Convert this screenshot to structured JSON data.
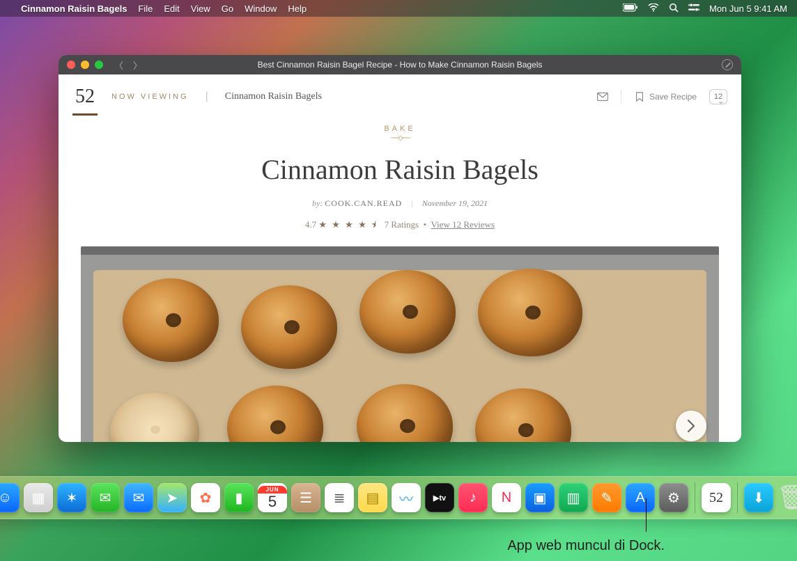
{
  "menubar": {
    "app_name": "Cinnamon Raisin Bagels",
    "items": [
      "File",
      "Edit",
      "View",
      "Go",
      "Window",
      "Help"
    ],
    "datetime": "Mon Jun 5  9:41 AM"
  },
  "window": {
    "title": "Best Cinnamon Raisin Bagel Recipe - How to Make Cinnamon Raisin Bagels",
    "header": {
      "logo_text": "52",
      "now_viewing_label": "NOW VIEWING",
      "breadcrumb_title": "Cinnamon Raisin Bagels",
      "save_label": "Save Recipe",
      "comment_count": "12"
    },
    "content": {
      "kicker": "BAKE",
      "title": "Cinnamon Raisin Bagels",
      "by_prefix": "by:",
      "author": "COOK.CAN.READ",
      "date": "November 19, 2021",
      "rating_value": "4.7",
      "stars_glyphs": "★ ★ ★ ★ ⯨",
      "rating_count": "7 Ratings",
      "reviews_link": "View 12 Reviews"
    }
  },
  "dock": {
    "items": [
      {
        "name": "finder",
        "bg": "linear-gradient(#2aa7ff,#0a66ff)",
        "glyph": "☺"
      },
      {
        "name": "launchpad",
        "bg": "linear-gradient(#e9e9e9,#cfcfcf)",
        "glyph": "▦"
      },
      {
        "name": "safari",
        "bg": "linear-gradient(#2fb4ff,#0b6bd6)",
        "glyph": "✶"
      },
      {
        "name": "messages",
        "bg": "linear-gradient(#5ae45d,#26b326)",
        "glyph": "✉"
      },
      {
        "name": "mail",
        "bg": "linear-gradient(#3fb7ff,#0a6bff)",
        "glyph": "✉"
      },
      {
        "name": "maps",
        "bg": "linear-gradient(#a5e86a,#34b0ff)",
        "glyph": "➤"
      },
      {
        "name": "photos",
        "bg": "#fff",
        "glyph": "✿",
        "fg": "#ff6b4a"
      },
      {
        "name": "facetime",
        "bg": "linear-gradient(#58e45a,#1fb51f)",
        "glyph": "▮"
      },
      {
        "name": "calendar",
        "bg": "#fff",
        "glyph": "",
        "fg": "#333"
      },
      {
        "name": "contacts",
        "bg": "linear-gradient(#d7b591,#b68e66)",
        "glyph": "☰"
      },
      {
        "name": "reminders",
        "bg": "#fff",
        "glyph": "≣",
        "fg": "#555"
      },
      {
        "name": "notes",
        "bg": "linear-gradient(#ffe680,#ffd94d)",
        "glyph": "▤",
        "fg": "#a98200"
      },
      {
        "name": "freeform",
        "bg": "#fff",
        "glyph": "〰",
        "fg": "#2aa7ff"
      },
      {
        "name": "tv",
        "bg": "#111",
        "glyph": "tv",
        "fg": "#fff"
      },
      {
        "name": "music",
        "bg": "linear-gradient(#ff5570,#ff2b55)",
        "glyph": "♪"
      },
      {
        "name": "news",
        "bg": "#fff",
        "glyph": "N",
        "fg": "#ff2b55"
      },
      {
        "name": "keynote",
        "bg": "linear-gradient(#1a9dff,#0a5fe0)",
        "glyph": "▣"
      },
      {
        "name": "numbers",
        "bg": "linear-gradient(#2fd276,#0fa851)",
        "glyph": "▥"
      },
      {
        "name": "pages",
        "bg": "linear-gradient(#ff9a2e,#ff7a00)",
        "glyph": "✎"
      },
      {
        "name": "appstore",
        "bg": "linear-gradient(#2aa7ff,#0a66ff)",
        "glyph": "A"
      },
      {
        "name": "settings",
        "bg": "linear-gradient(#8d8d8d,#5c5c5c)",
        "glyph": "⚙"
      }
    ],
    "calendar": {
      "month": "JUN",
      "day": "5"
    },
    "right_items": [
      {
        "name": "webapp-52",
        "bg": "#fff",
        "glyph": "52",
        "fg": "#333"
      },
      {
        "name": "downloads",
        "bg": "linear-gradient(#2ac9ff,#0aa4d6)",
        "glyph": "⬇"
      },
      {
        "name": "trash",
        "bg": "transparent",
        "glyph": "🗑",
        "fg": "#d8e4d4"
      }
    ]
  },
  "callout": {
    "text": "App web muncul di Dock."
  }
}
